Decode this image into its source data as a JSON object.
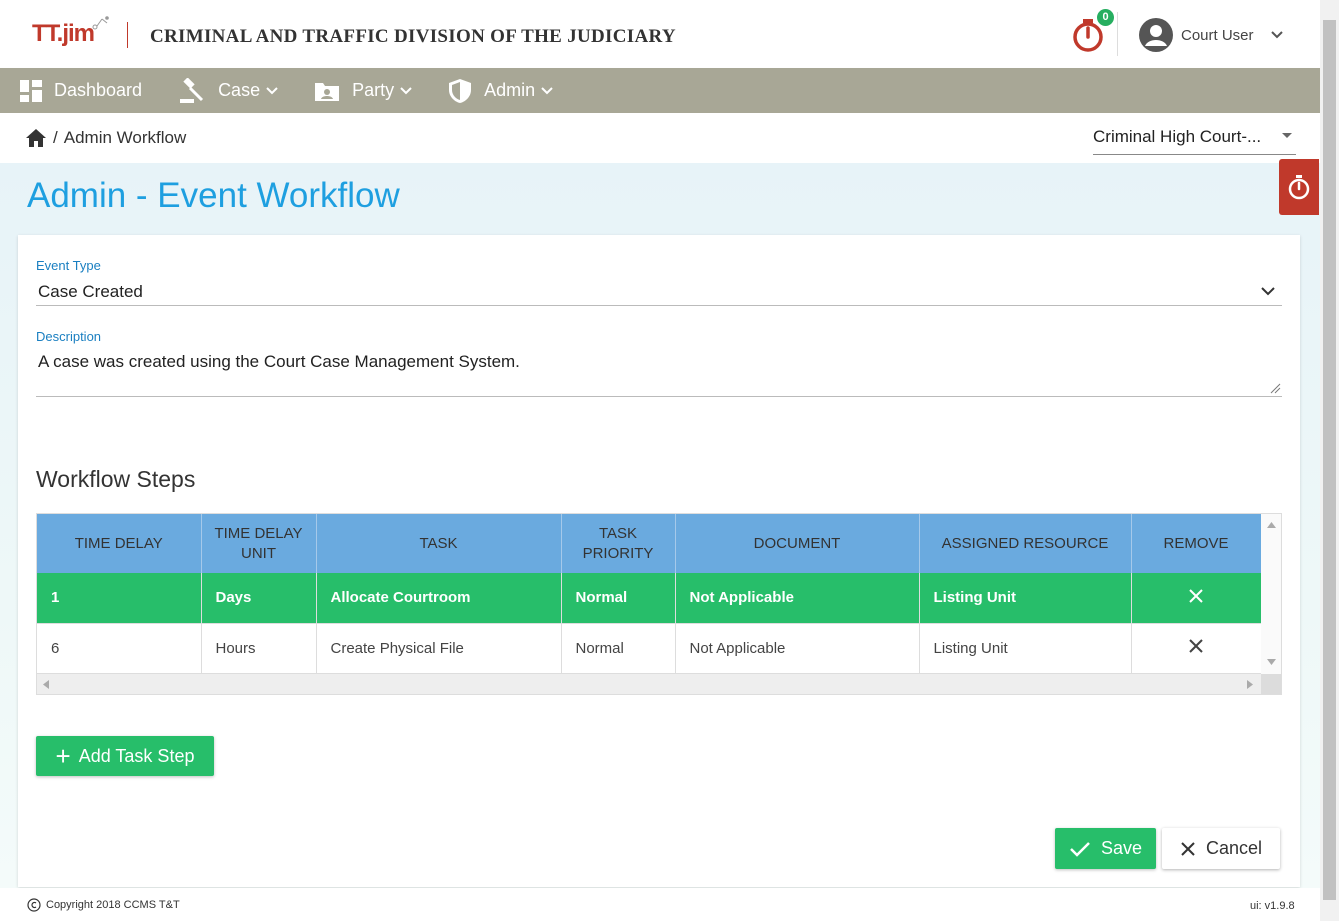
{
  "header": {
    "logo_text": "TT.jim",
    "app_title": "CRIMINAL AND TRAFFIC DIVISION OF THE JUDICIARY",
    "timer_count": "0",
    "user_name": "Court User"
  },
  "nav": {
    "items": [
      {
        "label": "Dashboard",
        "icon": "dashboard-icon"
      },
      {
        "label": "Case",
        "icon": "gavel-icon"
      },
      {
        "label": "Party",
        "icon": "contact-folder-icon"
      },
      {
        "label": "Admin",
        "icon": "shield-icon"
      }
    ]
  },
  "breadcrumb": {
    "separator": "/",
    "current": "Admin Workflow"
  },
  "court_select": {
    "value": "Criminal High Court-..."
  },
  "page": {
    "title": "Admin - Event Workflow"
  },
  "form": {
    "event_type_label": "Event Type",
    "event_type_value": "Case Created",
    "description_label": "Description",
    "description_value": "A case was created using the Court Case Management System."
  },
  "workflow": {
    "title": "Workflow Steps",
    "columns": [
      "TIME DELAY",
      "TIME DELAY UNIT",
      "TASK",
      "TASK PRIORITY",
      "DOCUMENT",
      "ASSIGNED RESOURCE",
      "REMOVE"
    ],
    "rows": [
      {
        "delay": "1",
        "unit": "Days",
        "task": "Allocate Courtroom",
        "priority": "Normal",
        "document": "Not Applicable",
        "resource": "Listing Unit",
        "selected": true
      },
      {
        "delay": "6",
        "unit": "Hours",
        "task": "Create Physical File",
        "priority": "Normal",
        "document": "Not Applicable",
        "resource": "Listing Unit",
        "selected": false
      }
    ]
  },
  "buttons": {
    "add_task": "Add Task Step",
    "save": "Save",
    "cancel": "Cancel"
  },
  "footer": {
    "copyright": "Copyright 2018  CCMS T&T",
    "version": "ui: v1.9.8"
  },
  "colors": {
    "accent_blue": "#1e9fe0",
    "nav_bg": "#a8a796",
    "green": "#27be6a",
    "red": "#c0392b",
    "table_header": "#6aaadf"
  }
}
